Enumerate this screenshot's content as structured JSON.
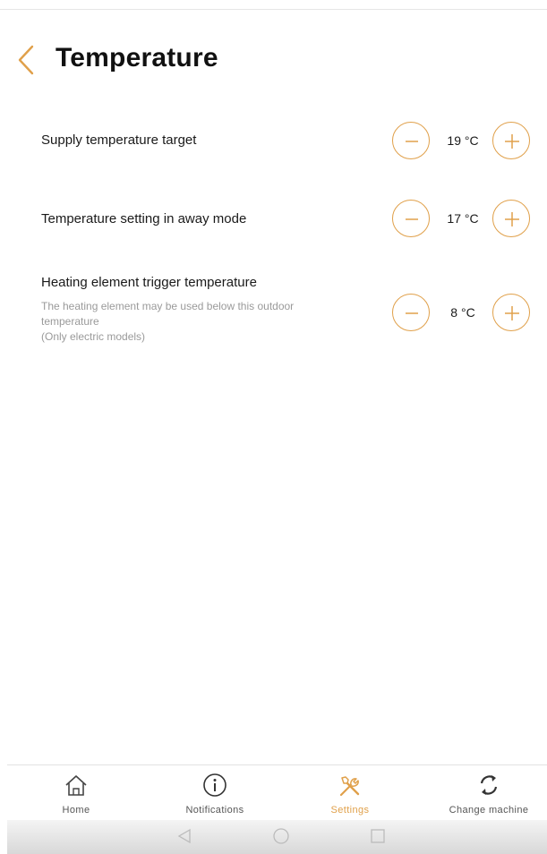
{
  "header": {
    "title": "Temperature"
  },
  "settings": [
    {
      "title": "Supply temperature target",
      "value": "19 °C"
    },
    {
      "title": "Temperature setting in away mode",
      "value": "17 °C"
    },
    {
      "title": "Heating element trigger temperature",
      "description": [
        "The heating element may be used below this outdoor",
        "temperature",
        "(Only electric models)"
      ],
      "value": "8 °C"
    }
  ],
  "nav": {
    "active": "Settings",
    "items": [
      {
        "label": "Home",
        "icon": "home-icon"
      },
      {
        "label": "Notifications",
        "icon": "info-icon"
      },
      {
        "label": "Settings",
        "icon": "tools-icon"
      },
      {
        "label": "Change machine",
        "icon": "refresh-icon"
      }
    ]
  },
  "colors": {
    "accent": "#e0a04a",
    "text": "#1a1a1a",
    "muted": "#9a9a9a"
  }
}
